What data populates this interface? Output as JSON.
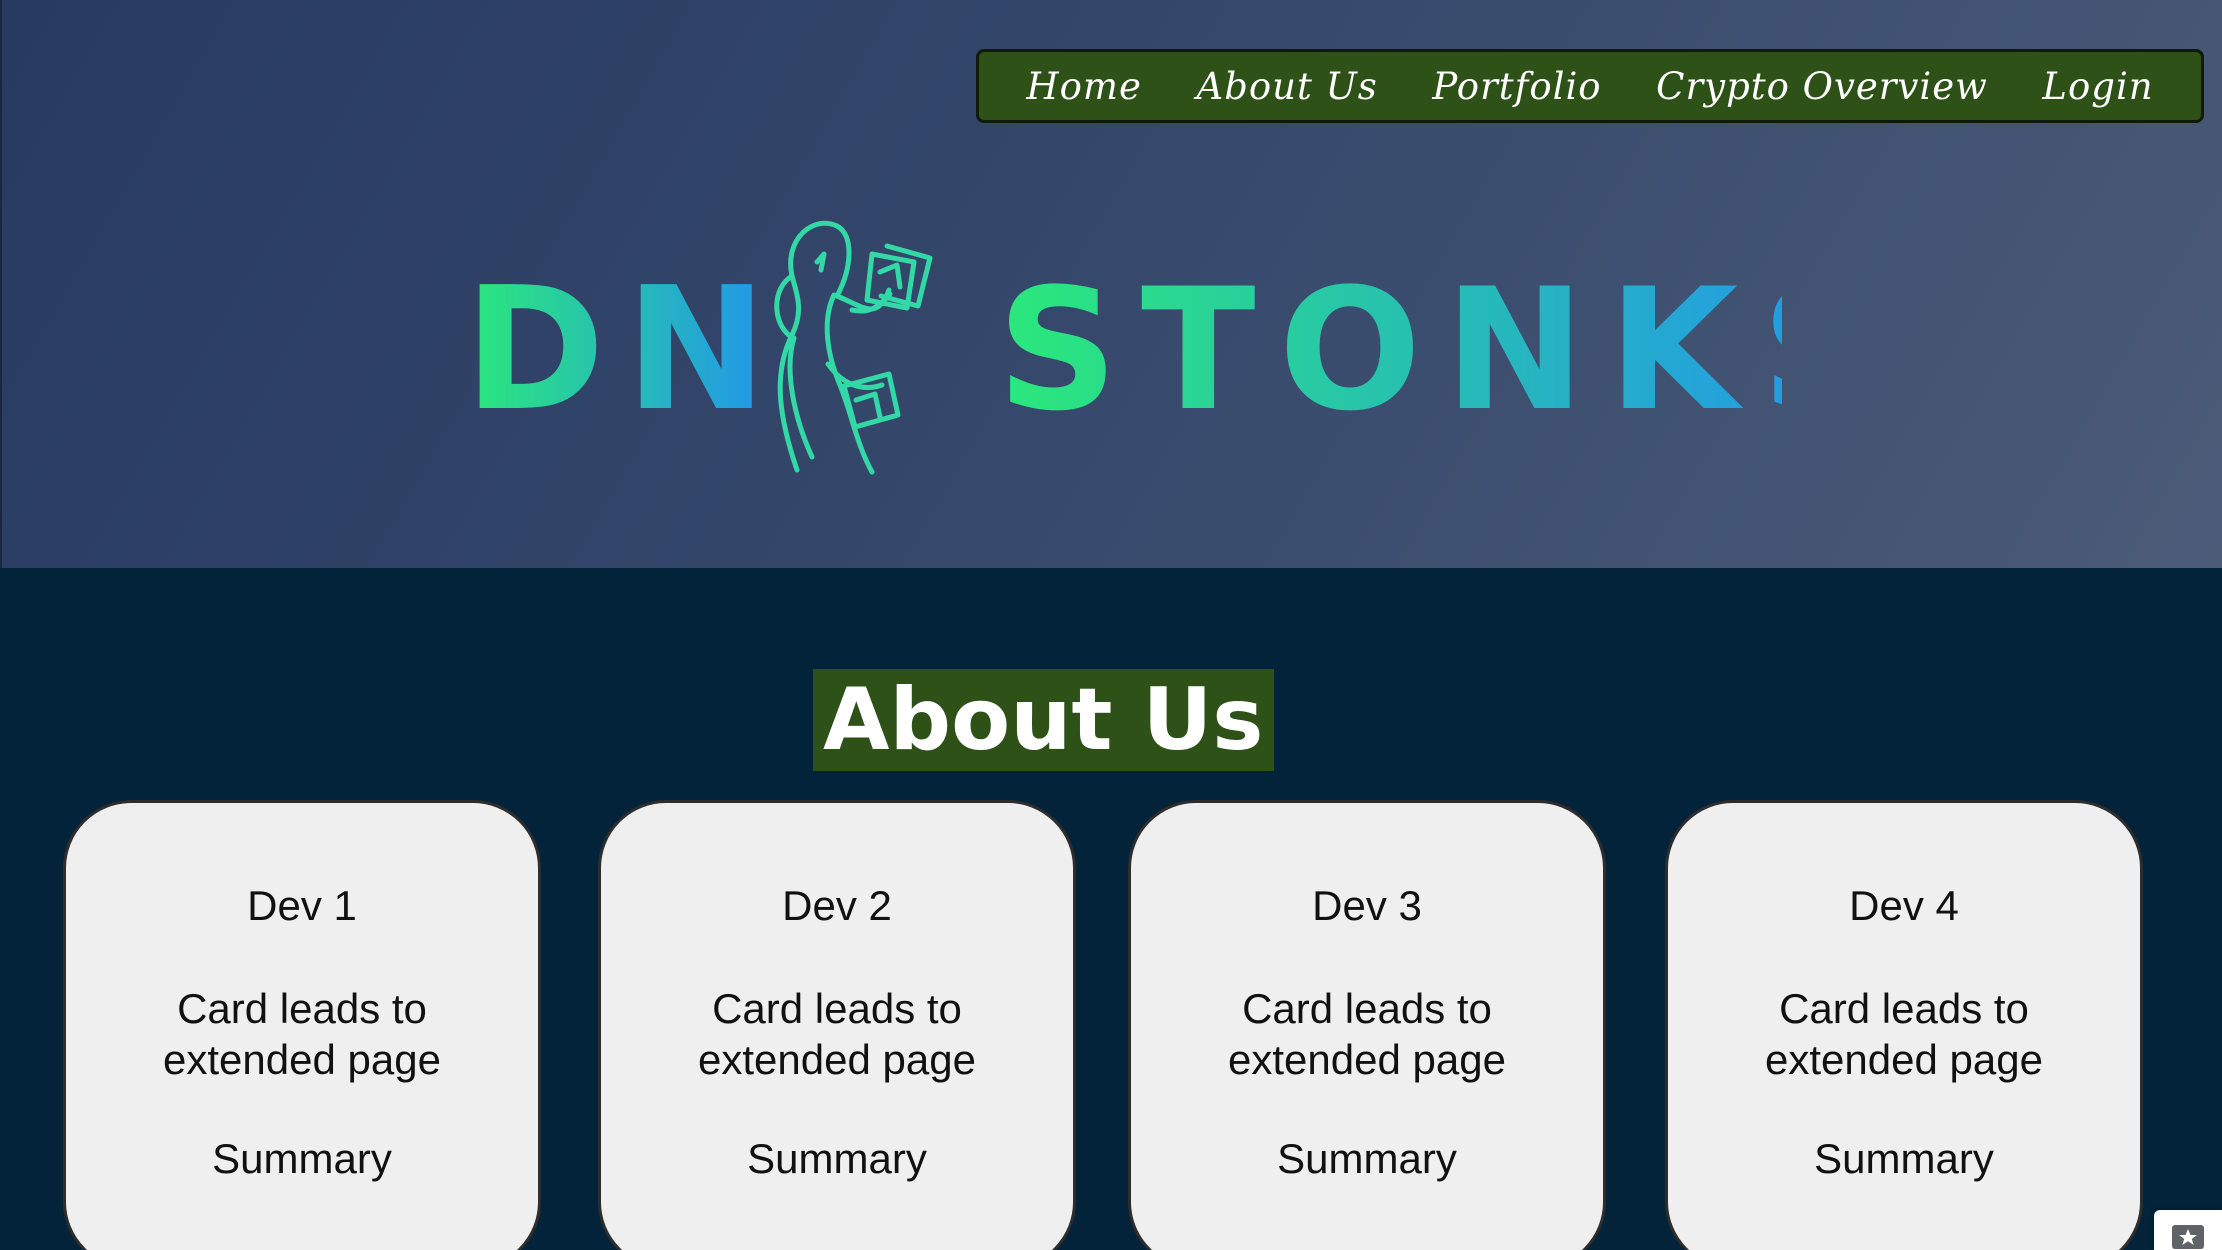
{
  "nav": {
    "items": [
      {
        "label": "Home"
      },
      {
        "label": "About Us"
      },
      {
        "label": "Portfolio"
      },
      {
        "label": "Crypto Overview"
      },
      {
        "label": "Login"
      }
    ]
  },
  "logo": {
    "left_text": "DN",
    "right_text": "STONKS",
    "gradient_start": "#2be87a",
    "gradient_end": "#2291f2",
    "icon_color": "#32d9a6"
  },
  "about": {
    "title": "About Us",
    "cards": [
      {
        "name": "Dev 1",
        "line1": "Card leads to",
        "line2": "extended page",
        "summary": "Summary"
      },
      {
        "name": "Dev 2",
        "line1": "Card leads to",
        "line2": "extended page",
        "summary": "Summary"
      },
      {
        "name": "Dev 3",
        "line1": "Card leads to",
        "line2": "extended page",
        "summary": "Summary"
      },
      {
        "name": "Dev 4",
        "line1": "Card leads to",
        "line2": "extended page",
        "summary": "Summary"
      }
    ]
  },
  "colors": {
    "hero_start": "#283a60",
    "hero_end": "#4b5b78",
    "nav_background": "#2e5118",
    "section_background": "#03233a",
    "card_background": "#efefef"
  },
  "corner": {
    "icon": "explore-icon"
  }
}
